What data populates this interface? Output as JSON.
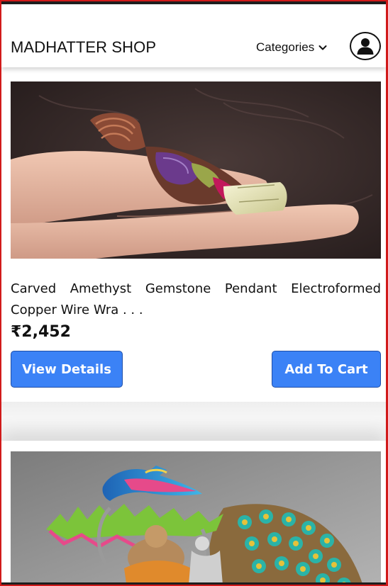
{
  "navbar": {
    "brand": "MADHATTER SHOP",
    "categories_label": "Categories"
  },
  "products": [
    {
      "title": "Carved Amethyst Gemstone Pendant Electroformed Copper Wire Wra . . .",
      "price": "₹2,452",
      "view_label": "View Details",
      "cart_label": "Add To Cart",
      "image": "photo of gemstone pendant held on fingers"
    },
    {
      "image": "photo of colorful metal peacock wall art with Ganesha figure"
    }
  ],
  "colors": {
    "button": "#3b82f6",
    "text": "#111111",
    "frame": "#d11a1a"
  },
  "icons": [
    "chevron-down-icon",
    "user-avatar-icon"
  ]
}
